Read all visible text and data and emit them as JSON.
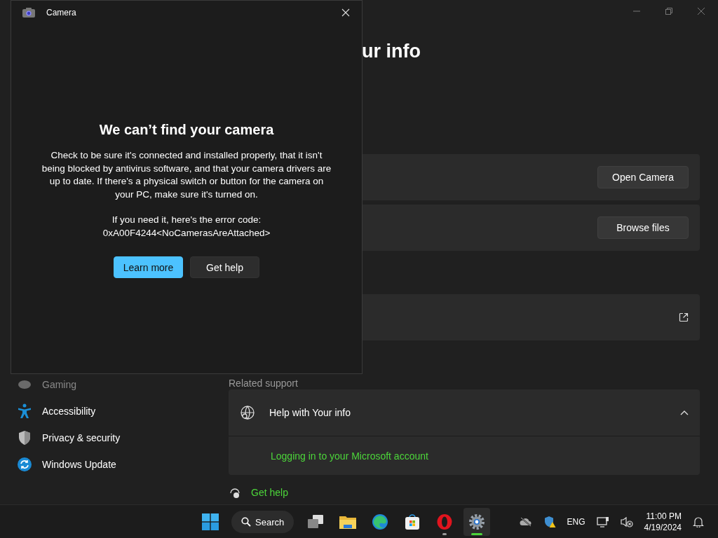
{
  "settings": {
    "heading": "ur info",
    "nav": [
      {
        "kind": "gaming",
        "label": "Gaming"
      },
      {
        "kind": "accessibility",
        "label": "Accessibility"
      },
      {
        "kind": "privacy",
        "label": "Privacy & security"
      },
      {
        "kind": "update",
        "label": "Windows Update"
      }
    ],
    "cards": [
      {
        "kind": "button",
        "button": "Open Camera"
      },
      {
        "kind": "button",
        "button": "Browse files"
      },
      {
        "kind": "external"
      }
    ],
    "related_label": "Related support",
    "help": {
      "title": "Help with Your info",
      "expanded": true,
      "links": [
        "Logging in to your Microsoft account"
      ]
    },
    "get_help": "Get help"
  },
  "camera": {
    "title": "Camera",
    "heading": "We can’t find your camera",
    "message": "Check to be sure it's connected and installed properly, that it isn't being blocked by antivirus software, and that your camera drivers are up to date. If there's a physical switch or button for the camera on your PC, make sure it's turned on.",
    "error_lines": [
      "If you need it, here's the error code:",
      "0xA00F4244<NoCamerasAreAttached>"
    ],
    "buttons": [
      {
        "label": "Learn more",
        "primary": true
      },
      {
        "label": "Get help",
        "primary": false
      }
    ]
  },
  "taskbar": {
    "search": "Search",
    "apps": [
      {
        "kind": "taskview",
        "running": false,
        "active": false
      },
      {
        "kind": "explorer",
        "running": false,
        "active": false
      },
      {
        "kind": "edge",
        "running": false,
        "active": false
      },
      {
        "kind": "store",
        "running": false,
        "active": false
      },
      {
        "kind": "opera",
        "running": true,
        "active": false
      },
      {
        "kind": "settings",
        "running": true,
        "active": true
      }
    ],
    "language": "ENG",
    "time": "11:00 PM",
    "date": "4/19/2024"
  }
}
